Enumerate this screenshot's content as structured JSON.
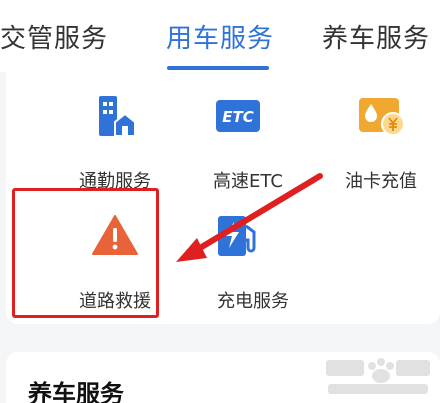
{
  "tabs": [
    {
      "label": "交管服务",
      "active": false
    },
    {
      "label": "用车服务",
      "active": true
    },
    {
      "label": "养车服务",
      "active": false
    }
  ],
  "services": [
    {
      "label": "通勤服务",
      "icon": "commute-building-icon"
    },
    {
      "label": "高速ETC",
      "icon": "etc-icon",
      "icon_text": "ETC"
    },
    {
      "label": "油卡充值",
      "icon": "fuel-card-icon"
    },
    {
      "label": "道路救援",
      "icon": "warning-triangle-icon"
    },
    {
      "label": "充电服务",
      "icon": "charging-station-icon"
    }
  ],
  "section": {
    "title": "养车服务"
  },
  "colors": {
    "accent": "#2f73d9",
    "highlight": "#e02020",
    "warning": "#e8633a",
    "gold": "#f0a830"
  }
}
